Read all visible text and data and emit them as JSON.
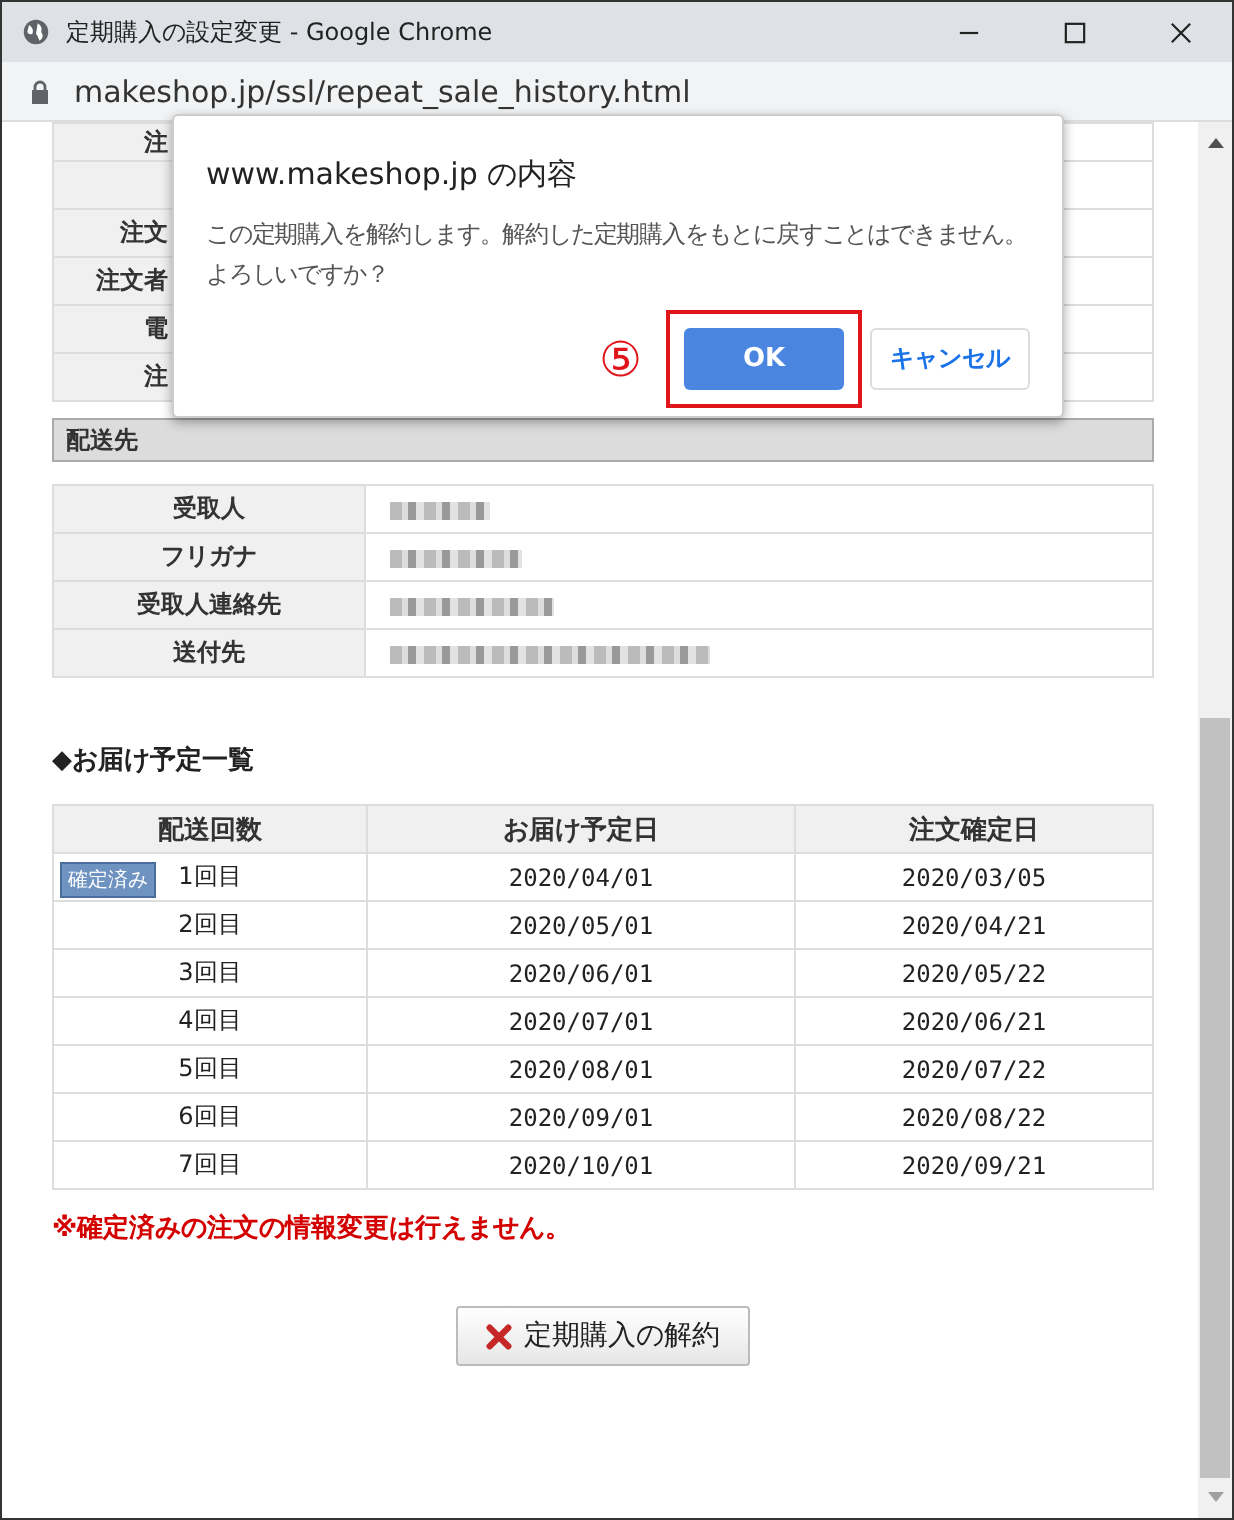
{
  "window": {
    "title": "定期購入の設定変更 - Google Chrome",
    "url": "makeshop.jp/ssl/repeat_sale_history.html"
  },
  "order_rows": [
    {
      "label": "注"
    },
    {},
    {
      "label": "注文"
    },
    {
      "label": "注文者"
    },
    {
      "label": "電"
    },
    {
      "label": "注"
    }
  ],
  "shipping": {
    "heading": "配送先",
    "rows": [
      {
        "label": "受取人",
        "value_blurred": true
      },
      {
        "label": "フリガナ",
        "value_blurred": true
      },
      {
        "label": "受取人連絡先",
        "value_blurred": true
      },
      {
        "label": "送付先",
        "value_blurred": true
      }
    ]
  },
  "schedule": {
    "heading": "◆お届け予定一覧",
    "columns": [
      "配送回数",
      "お届け予定日",
      "注文確定日"
    ],
    "rows": [
      {
        "badge": "確定済み",
        "count": "1回目",
        "delivery": "2020/04/01",
        "order": "2020/03/05"
      },
      {
        "count": "2回目",
        "delivery": "2020/05/01",
        "order": "2020/04/21"
      },
      {
        "count": "3回目",
        "delivery": "2020/06/01",
        "order": "2020/05/22"
      },
      {
        "count": "4回目",
        "delivery": "2020/07/01",
        "order": "2020/06/21"
      },
      {
        "count": "5回目",
        "delivery": "2020/08/01",
        "order": "2020/07/22"
      },
      {
        "count": "6回目",
        "delivery": "2020/09/01",
        "order": "2020/08/22"
      },
      {
        "count": "7回目",
        "delivery": "2020/10/01",
        "order": "2020/09/21"
      }
    ]
  },
  "notice": "※確定済みの注文の情報変更は行えません。",
  "cancel_button": "定期購入の解約",
  "dialog": {
    "title": "www.makeshop.jp の内容",
    "message": "この定期購入を解約します。解約した定期購入をもとに戻すことはできません。よろしいですか？",
    "step_mark": "⑤",
    "ok": {
      "label": "OK",
      "highlighted": true
    },
    "cancel": "キャンセル"
  }
}
